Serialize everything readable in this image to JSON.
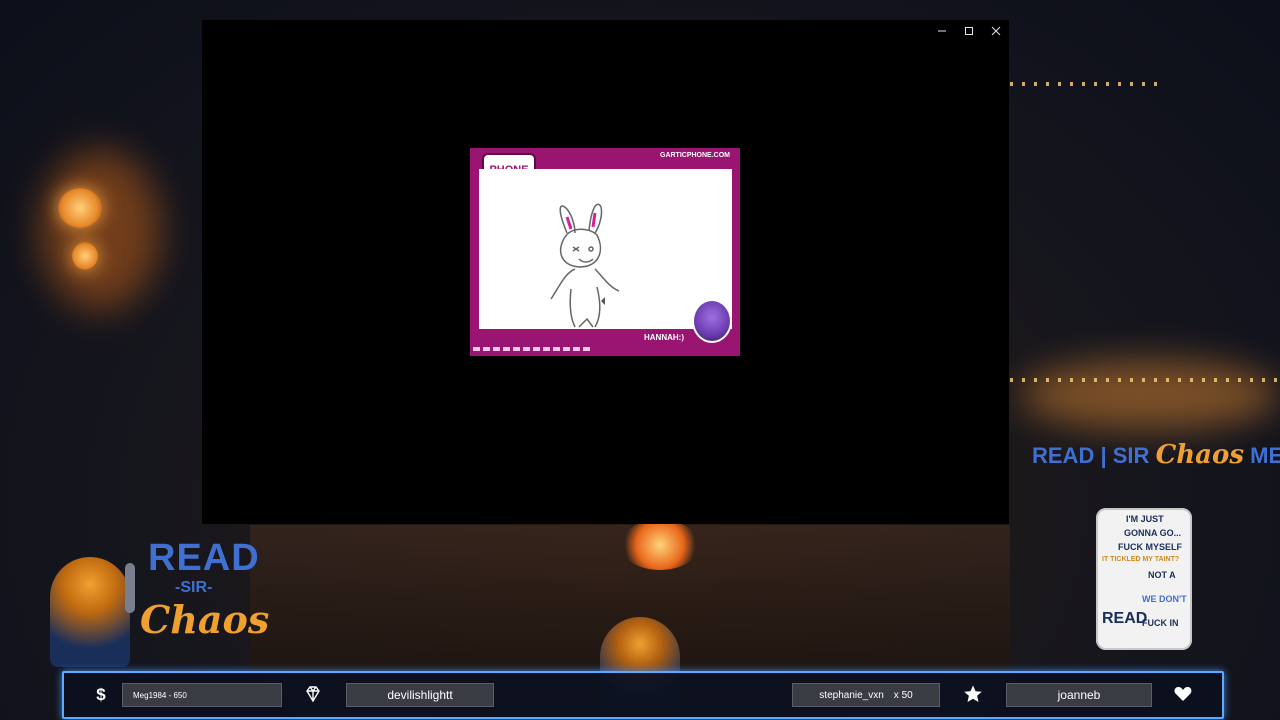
{
  "window": {
    "minimize_icon": "minimize-icon",
    "maximize_icon": "maximize-icon",
    "close_icon": "close-icon"
  },
  "gartic": {
    "logo_text": "PHONE",
    "site": "GARTICPHONE.COM",
    "player_name": "HANNAH:)"
  },
  "branding": {
    "read": "READ",
    "sir": "-SIR-",
    "chaos": "Chaos",
    "merch_read": "READ",
    "merch_sep": "|",
    "merch_sir": "SIR",
    "merch_chaos": "Chaos",
    "merch_word": "MERCH"
  },
  "mug_text": [
    "I'M JUST",
    "GONNA GO...",
    "FUCK MYSELF",
    "IT TICKLED MY TAINT?",
    "NOT A",
    "READ",
    "WE DON'T",
    "FUCK IN"
  ],
  "bottom_bar": {
    "dollar_icon": "dollar-icon",
    "donation": "Meg1984 - 650",
    "diamond_icon": "diamond-icon",
    "subscriber": "devilishlightt",
    "bits_user": "stephanie_vxn",
    "bits_count": "x 50",
    "star_icon": "star-icon",
    "follower": "joanneb",
    "heart_icon": "heart-icon"
  }
}
